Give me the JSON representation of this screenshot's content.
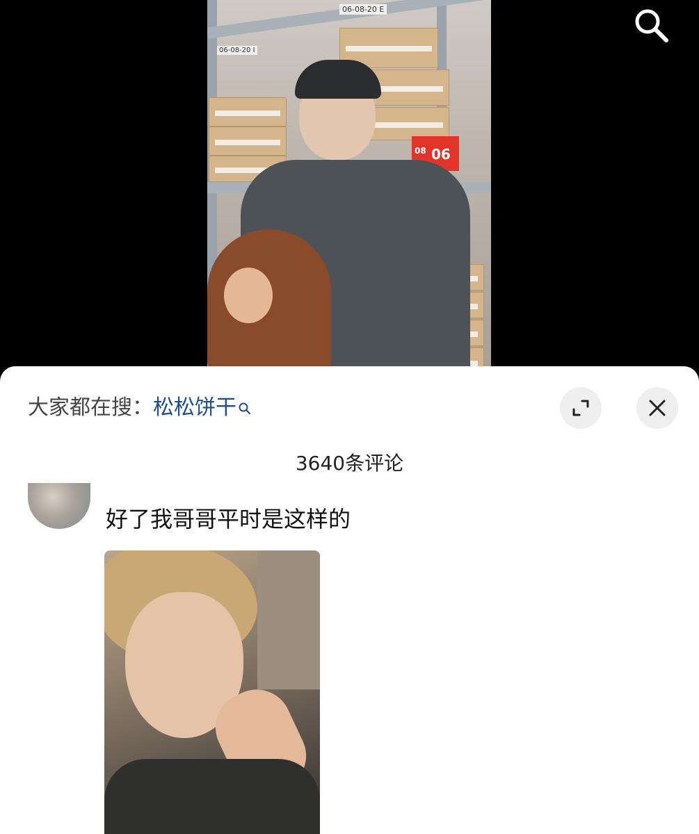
{
  "video": {
    "shelf_labels": [
      "06-08-20 E",
      "06-08-20 I"
    ],
    "tag_small": "08",
    "tag_big": "06"
  },
  "topbar": {
    "search_icon": "search-icon"
  },
  "sheet": {
    "trending_prefix": "大家都在搜：",
    "trending_term": "松松饼干",
    "trending_icon": "magnifier-small-icon",
    "expand_icon": "expand-icon",
    "close_icon": "close-icon",
    "comment_count": "3640条评论"
  },
  "comments": [
    {
      "text": "好了我哥哥平时是这样的",
      "has_image": true
    }
  ],
  "colors": {
    "trending_term": "#1f4e8f",
    "sheet_bg": "#ffffff",
    "button_bg": "#efefef"
  }
}
